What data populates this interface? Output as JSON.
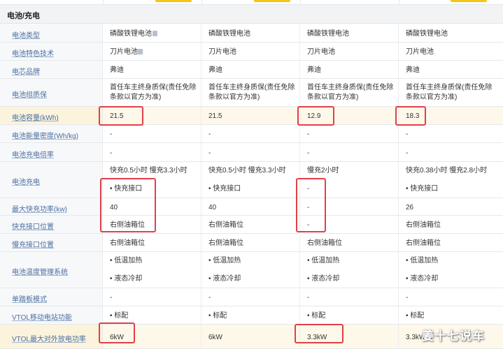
{
  "section": {
    "title": "电池/充电"
  },
  "rows": [
    {
      "label": "电池类型",
      "label_icon": true,
      "cells": [
        "磷酸铁锂电池",
        "磷酸铁锂电池",
        "磷酸铁锂电池",
        "磷酸铁锂电池"
      ]
    },
    {
      "label": "电池特色技术",
      "label_icon": true,
      "cells": [
        "刀片电池",
        "刀片电池",
        "刀片电池",
        "刀片电池"
      ]
    },
    {
      "label": "电芯品牌",
      "cells": [
        "弗迪",
        "弗迪",
        "弗迪",
        "弗迪"
      ]
    },
    {
      "label": "电池组质保",
      "cells": [
        [
          "首任车主终身质保(责任免除",
          "条款以官方为准)"
        ],
        [
          "首任车主终身质保(责任免除",
          "条款以官方为准)"
        ],
        [
          "首任车主终身质保(责任免除",
          "条款以官方为准)"
        ],
        [
          "首任车主终身质保(责任免除",
          "条款以官方为准)"
        ]
      ]
    },
    {
      "label": "电池容量(kWh)",
      "highlight": true,
      "cells": [
        "21.5",
        "21.5",
        "12.9",
        "18.3"
      ]
    },
    {
      "label": "电池能量密度(Wh/kg)",
      "cells": [
        "-",
        "-",
        "-",
        "-"
      ]
    },
    {
      "label": "电池充电倍率",
      "cells": [
        "-",
        "-",
        "-",
        "-"
      ]
    },
    {
      "label": "电池充电",
      "cells": [
        [
          "快充0.5小时 慢充3.3小时",
          "• 快充接口"
        ],
        [
          "快充0.5小时 慢充3.3小时",
          "• 快充接口"
        ],
        [
          "慢充2小时",
          "-"
        ],
        [
          "快充0.38小时 慢充2.8小时",
          "• 快充接口"
        ]
      ]
    },
    {
      "label": "最大快充功率(kw)",
      "cells": [
        "40",
        "40",
        "-",
        "26"
      ]
    },
    {
      "label": "快充接口位置",
      "cells": [
        "右侧油箱位",
        "右侧油箱位",
        "-",
        "右侧油箱位"
      ]
    },
    {
      "label": "慢充接口位置",
      "cells": [
        "右侧油箱位",
        "右侧油箱位",
        "右侧油箱位",
        "右侧油箱位"
      ]
    },
    {
      "label": "电池温度管理系统",
      "cells": [
        [
          "• 低温加热",
          "• 液态冷却"
        ],
        [
          "• 低温加热",
          "• 液态冷却"
        ],
        [
          "• 低温加热",
          "• 液态冷却"
        ],
        [
          "• 低温加热",
          "• 液态冷却"
        ]
      ]
    },
    {
      "label": "单踏板模式",
      "cells": [
        "-",
        "-",
        "-",
        "-"
      ]
    },
    {
      "label": "VTOL移动电站功能",
      "cells": [
        "• 标配",
        "• 标配",
        "• 标配",
        "• 标配"
      ]
    },
    {
      "label": "VTOL最大对外放电功率",
      "highlight": true,
      "cells": [
        "6kW",
        "6kW",
        "3.3kW",
        "3.3kW"
      ]
    }
  ],
  "watermark": "姜十七说车",
  "colors": {
    "highlight_box": "#e0404a",
    "label_link": "#4a6fa0",
    "tab_accent": "#f5c518"
  }
}
